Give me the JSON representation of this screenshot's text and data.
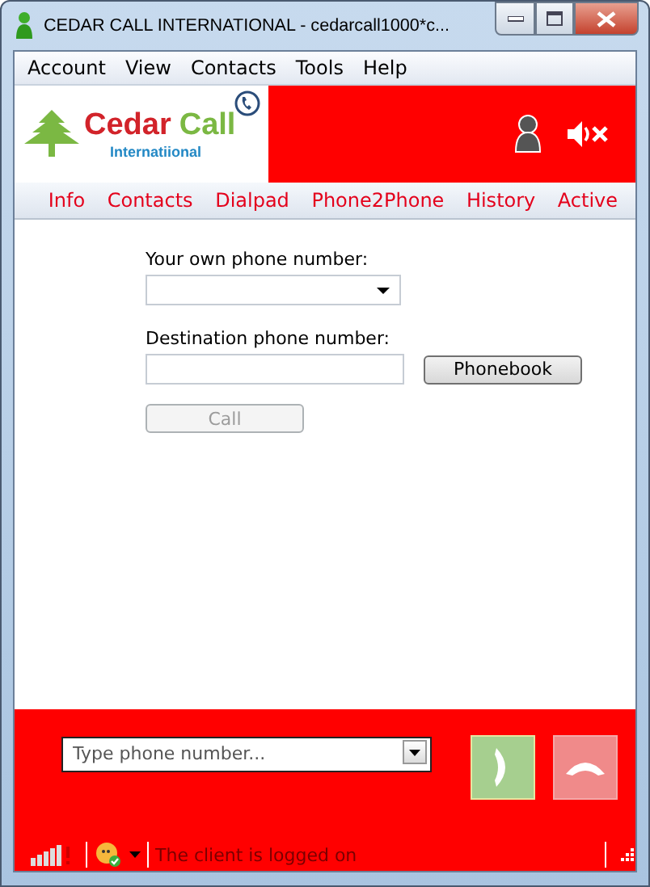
{
  "window": {
    "title": "CEDAR CALL INTERNATIONAL - cedarcall1000*c..."
  },
  "menu": [
    "Account",
    "View",
    "Contacts",
    "Tools",
    "Help"
  ],
  "logo": {
    "first": "Cedar",
    "second": "Call",
    "tagline": "Internatiional"
  },
  "tabs": [
    "Info",
    "Contacts",
    "Dialpad",
    "Phone2Phone",
    "History",
    "Active"
  ],
  "form": {
    "own_label": "Your own phone number:",
    "dest_label": "Destination phone number:",
    "phonebook_button": "Phonebook",
    "call_button": {
      "label": "Call",
      "disabled": true
    }
  },
  "dial": {
    "placeholder": "Type phone number...",
    "call_disabled": true,
    "hangup_disabled": true
  },
  "status_bar": {
    "message": "The client is logged on"
  }
}
